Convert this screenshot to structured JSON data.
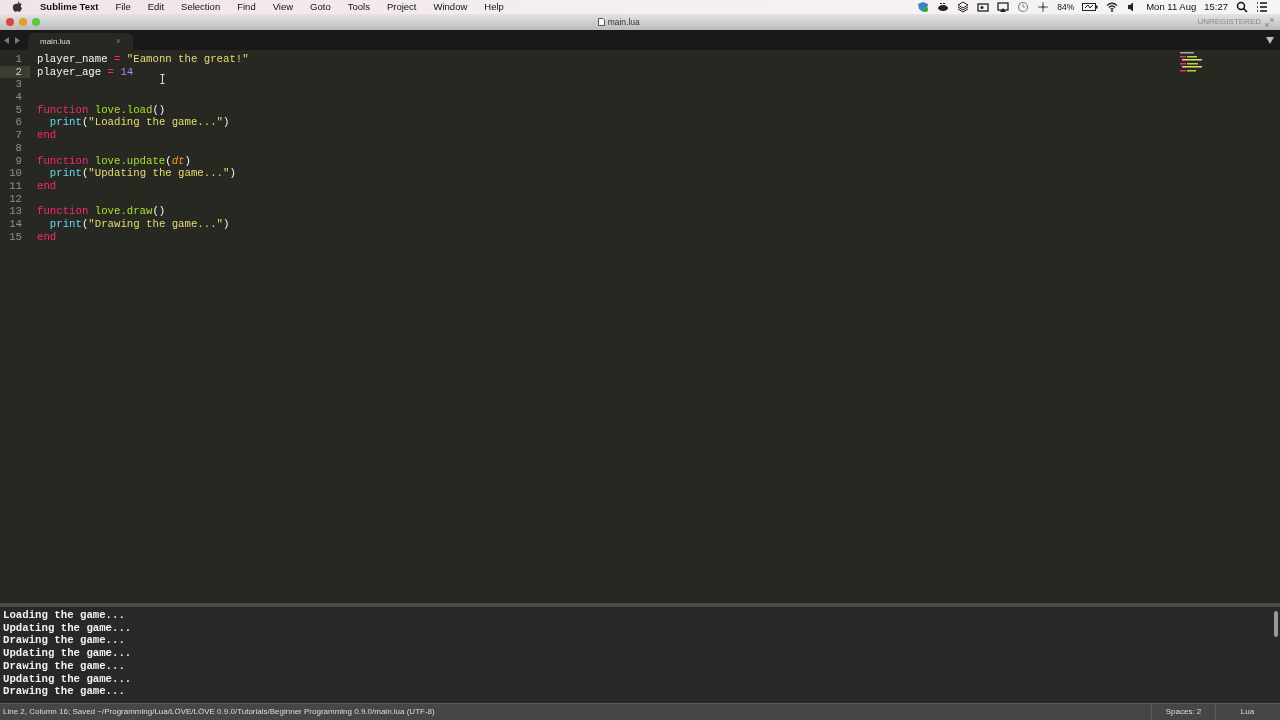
{
  "menu_bar": {
    "app_name": "Sublime Text",
    "menus": [
      "File",
      "Edit",
      "Selection",
      "Find",
      "View",
      "Goto",
      "Tools",
      "Project",
      "Window",
      "Help"
    ],
    "battery": "84%",
    "date": "Mon 11 Aug",
    "time": "15:27"
  },
  "window": {
    "title": "main.lua",
    "license": "UNREGISTERED"
  },
  "tabs": [
    {
      "label": "main.lua",
      "selected": true,
      "close": "×"
    }
  ],
  "editor": {
    "lines": [
      {
        "number": "1",
        "current": false,
        "tokens": [
          {
            "text": "player_name",
            "kind": "plain"
          },
          {
            "text": " = ",
            "kind": "operator"
          },
          {
            "text": "\"Eamonn the great!\"",
            "kind": "string"
          }
        ]
      },
      {
        "number": "2",
        "current": true,
        "tokens": [
          {
            "text": "player_age",
            "kind": "plain"
          },
          {
            "text": " = ",
            "kind": "operator"
          },
          {
            "text": "14",
            "kind": "number"
          }
        ]
      },
      {
        "number": "3",
        "current": false
      },
      {
        "number": "4",
        "current": false
      },
      {
        "number": "5",
        "current": false,
        "tokens": [
          {
            "text": "function",
            "kind": "keyword"
          },
          {
            "text": " love.load",
            "kind": "function"
          },
          {
            "text": "()",
            "kind": "plain"
          }
        ]
      },
      {
        "number": "6",
        "current": false,
        "tokens": [
          {
            "text": "  print",
            "kind": "builtin"
          },
          {
            "text": "(",
            "kind": "plain"
          },
          {
            "text": "\"Loading the game...\"",
            "kind": "string"
          },
          {
            "text": ")",
            "kind": "plain"
          }
        ]
      },
      {
        "number": "7",
        "current": false,
        "tokens": [
          {
            "text": "end",
            "kind": "keyword"
          }
        ]
      },
      {
        "number": "8",
        "current": false
      },
      {
        "number": "9",
        "current": false,
        "tokens": [
          {
            "text": "function",
            "kind": "keyword"
          },
          {
            "text": " love.update",
            "kind": "function"
          },
          {
            "text": "(",
            "kind": "plain"
          },
          {
            "text": "dt",
            "kind": "param"
          },
          {
            "text": ")",
            "kind": "plain"
          }
        ]
      },
      {
        "number": "10",
        "current": false,
        "tokens": [
          {
            "text": "  print",
            "kind": "builtin"
          },
          {
            "text": "(",
            "kind": "plain"
          },
          {
            "text": "\"Updating the game...\"",
            "kind": "string"
          },
          {
            "text": ")",
            "kind": "plain"
          }
        ]
      },
      {
        "number": "11",
        "current": false,
        "tokens": [
          {
            "text": "end",
            "kind": "keyword"
          }
        ]
      },
      {
        "number": "12",
        "current": false
      },
      {
        "number": "13",
        "current": false,
        "tokens": [
          {
            "text": "function",
            "kind": "keyword"
          },
          {
            "text": " love.draw",
            "kind": "function"
          },
          {
            "text": "()",
            "kind": "plain"
          }
        ]
      },
      {
        "number": "14",
        "current": false,
        "tokens": [
          {
            "text": "  print",
            "kind": "builtin"
          },
          {
            "text": "(",
            "kind": "plain"
          },
          {
            "text": "\"Drawing the game...\"",
            "kind": "string"
          },
          {
            "text": ")",
            "kind": "plain"
          }
        ]
      },
      {
        "number": "15",
        "current": false,
        "tokens": [
          {
            "text": "end",
            "kind": "keyword"
          }
        ]
      }
    ]
  },
  "output_panel": {
    "lines": [
      "Loading the game...",
      "Updating the game...",
      "Drawing the game...",
      "Updating the game...",
      "Drawing the game...",
      "Updating the game...",
      "Drawing the game..."
    ]
  },
  "status_bar": {
    "message": "Line 2, Column 16; Saved ~/Programming/Lua/LÖVE/LÖVE 0.9.0/Tutorials/Beginner Programming 0.9.0/main.lua (UTF-8)",
    "indentation": "Spaces: 2",
    "syntax": "Lua"
  }
}
